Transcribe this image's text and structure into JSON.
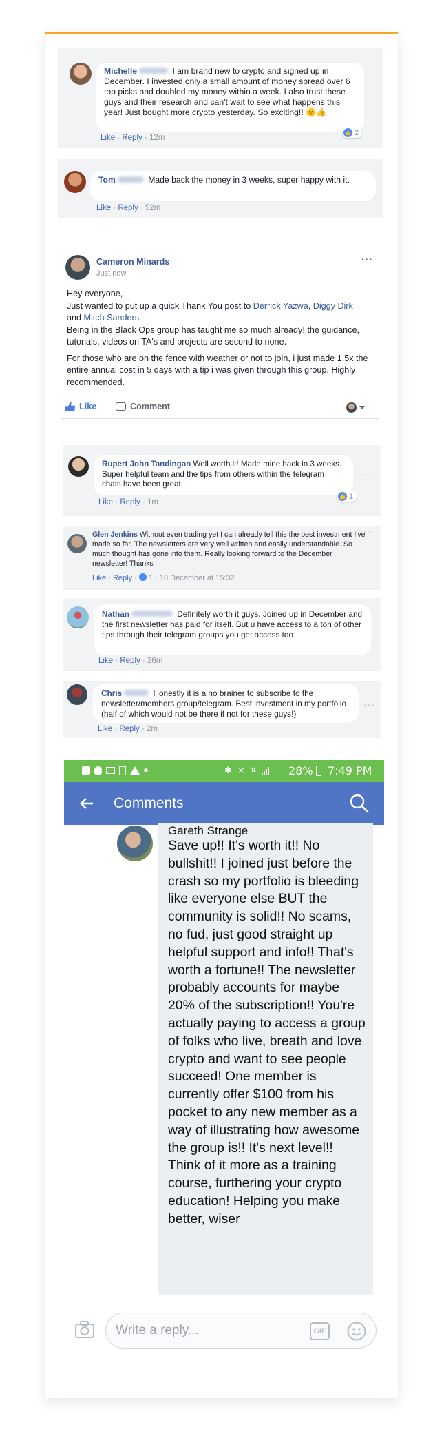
{
  "comments_top": [
    {
      "name": "Michelle",
      "text": "I am brand new to crypto and signed up in December. I invested only a small amount of money spread over 6 top picks and doubled my money within a week. I also trust these guys and their research and can't wait to see what happens this year! Just bought more crypto yesterday. So exciting!! 🌞👍",
      "like": "Like",
      "reply": "Reply",
      "time": "12m",
      "reactions": "2"
    },
    {
      "name": "Tom",
      "text": "Made back the money in 3 weeks, super happy with it.",
      "like": "Like",
      "reply": "Reply",
      "time": "52m"
    }
  ],
  "post": {
    "author": "Cameron Minards",
    "time": "Just now",
    "more": "···",
    "p1_line1": "Hey everyone,",
    "p1_line2": "Just wanted to put up a quick Thank You post to",
    "link1": "Derrick Yazwa",
    "comma": ",",
    "link2": "Diggy Dirk",
    "and": "and",
    "link3": "Mitch Sanders",
    "period": ".",
    "p1_line3": "Being in the Black Ops group has taught me so much already! the guidance, tutorials, videos on TA's and projects are second to none.",
    "p2": "For those who are on the fence with weather or not to join, i just made 1.5x the entire annual cost in 5 days with a tip i was given through this group. Highly recommended.",
    "like_label": "Like",
    "comment_label": "Comment"
  },
  "comments_mid": [
    {
      "name": "Rupert John Tandingan",
      "text": "Well worth it! Made mine back in 3 weeks. Super helpful team and the tips from others within the telegram chats have been great.",
      "like": "Like",
      "reply": "Reply",
      "time": "1m",
      "reactions": "1"
    },
    {
      "name": "Glen Jenkins",
      "text": "Without even trading yet I can already tell this the best investment I've made so far. The newsletters are very well written and easily understandable. So much thought has gone into them. Really looking forward to the December newsletter! Thanks",
      "like": "Like",
      "reply": "Reply",
      "reactions": "1",
      "time": "10 December at 15:32"
    },
    {
      "name": "Nathan",
      "text": "Definitely worth it guys. Joined up in December and the first newsletter has paid for itself. But u have access to a ton of other tips through their telegram groups you get access too",
      "like": "Like",
      "reply": "Reply",
      "time": "26m"
    },
    {
      "name": "Chris",
      "text": "Honestly it is a no brainer to subscribe to the newsletter/members group/telegram. Best investment in my portfolio (half of which would not be there if not for these guys!)",
      "like": "Like",
      "reply": "Reply",
      "time": "2m"
    }
  ],
  "mobile": {
    "battery": "28%",
    "clock": "7:49 PM",
    "title": "Comments",
    "commenter": "Gareth Strange",
    "comment": "Save up!! It's worth it!! No bullshit!! I joined just before the crash so my portfolio is bleeding like everyone else BUT the community is solid!! No scams, no fud, just good straight up helpful support and info!! That's worth a fortune!! The newsletter probably accounts for maybe 20% of the subscription!! You're actually paying to access a group of folks who live, breath and love crypto and want to see people succeed! One member is currently offer $100 from his pocket to any new member as a way of illustrating how awesome the group is!! It's next level!! Think of it more as a training course, furthering your crypto education! Helping you make better, wiser",
    "reply_placeholder": "Write a reply...",
    "gif_label": "GIF"
  },
  "colors": {
    "accent_line": "#f5a623",
    "fb_blue": "#385898",
    "status_green": "#6bbf4e",
    "appbar_blue": "#4f75c4"
  }
}
